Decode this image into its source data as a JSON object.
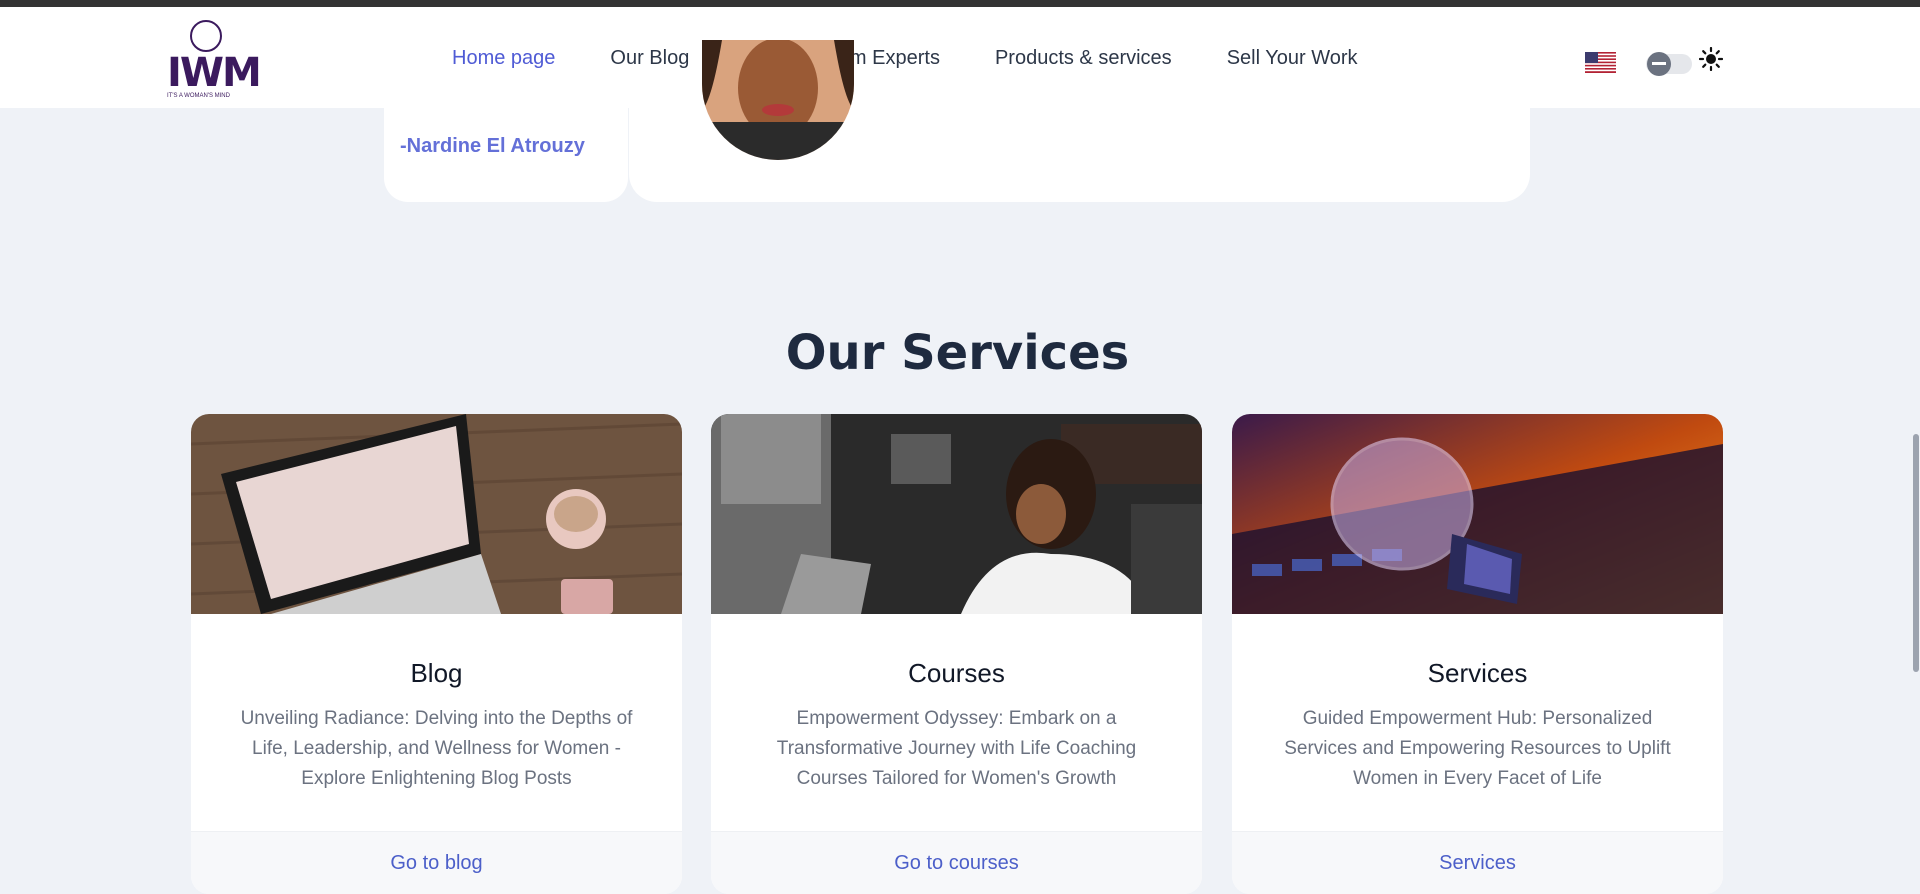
{
  "nav": {
    "items": [
      {
        "label": "Home page",
        "active": true
      },
      {
        "label": "Our Blog",
        "active": false
      },
      {
        "label": "Advices From Experts",
        "active": false
      },
      {
        "label": "Products & services",
        "active": false
      },
      {
        "label": "Sell Your Work",
        "active": false
      }
    ],
    "logo_text": "IWM",
    "logo_tagline": "IT'S A WOMAN'S MIND",
    "language_icon": "us-flag-icon",
    "theme_toggle_icon": "sun-icon"
  },
  "testimonial": {
    "name": "-Nardine El Atrouzy"
  },
  "services": {
    "title": "Our Services",
    "cards": [
      {
        "title": "Blog",
        "description": "Unveiling Radiance: Delving into the Depths of Life, Leadership, and Wellness for Women - Explore Enlightening Blog Posts",
        "link": "Go to blog",
        "image": "laptop-coffee-image"
      },
      {
        "title": "Courses",
        "description": "Empowerment Odyssey: Embark on a Transformative Journey with Life Coaching Courses Tailored for Women's Growth",
        "link": "Go to courses",
        "image": "woman-studying-image"
      },
      {
        "title": "Services",
        "description": "Guided Empowerment Hub: Personalized Services and Empowering Resources to Uplift Women in Every Facet of Life",
        "link": "Services",
        "image": "lightbulb-keyboard-image"
      }
    ]
  },
  "colors": {
    "accent": "#4f5bd5",
    "brand": "#3b1a5e",
    "background": "#eff2f7"
  }
}
